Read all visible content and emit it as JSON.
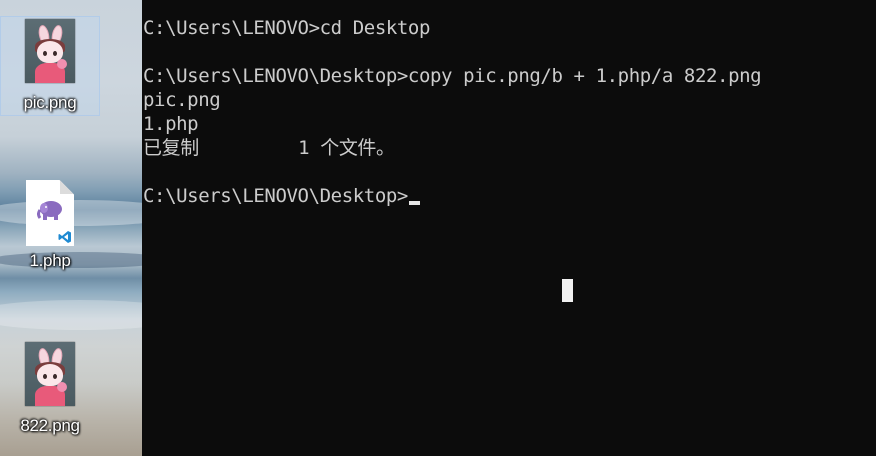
{
  "desktop": {
    "icons": [
      {
        "label": "pic.png",
        "type": "image-thumbnail"
      },
      {
        "label": "1.php",
        "type": "php-file"
      },
      {
        "label": "822.png",
        "type": "image-thumbnail"
      }
    ]
  },
  "console": {
    "lines": [
      "C:\\Users\\LENOVO>cd Desktop",
      "",
      "C:\\Users\\LENOVO\\Desktop>copy pic.png/b + 1.php/a 822.png",
      "pic.png",
      "1.php",
      "已复制         1 个文件。",
      "",
      "C:\\Users\\LENOVO\\Desktop>"
    ],
    "colors": {
      "background": "#0c0c0c",
      "text": "#cccccc"
    }
  }
}
